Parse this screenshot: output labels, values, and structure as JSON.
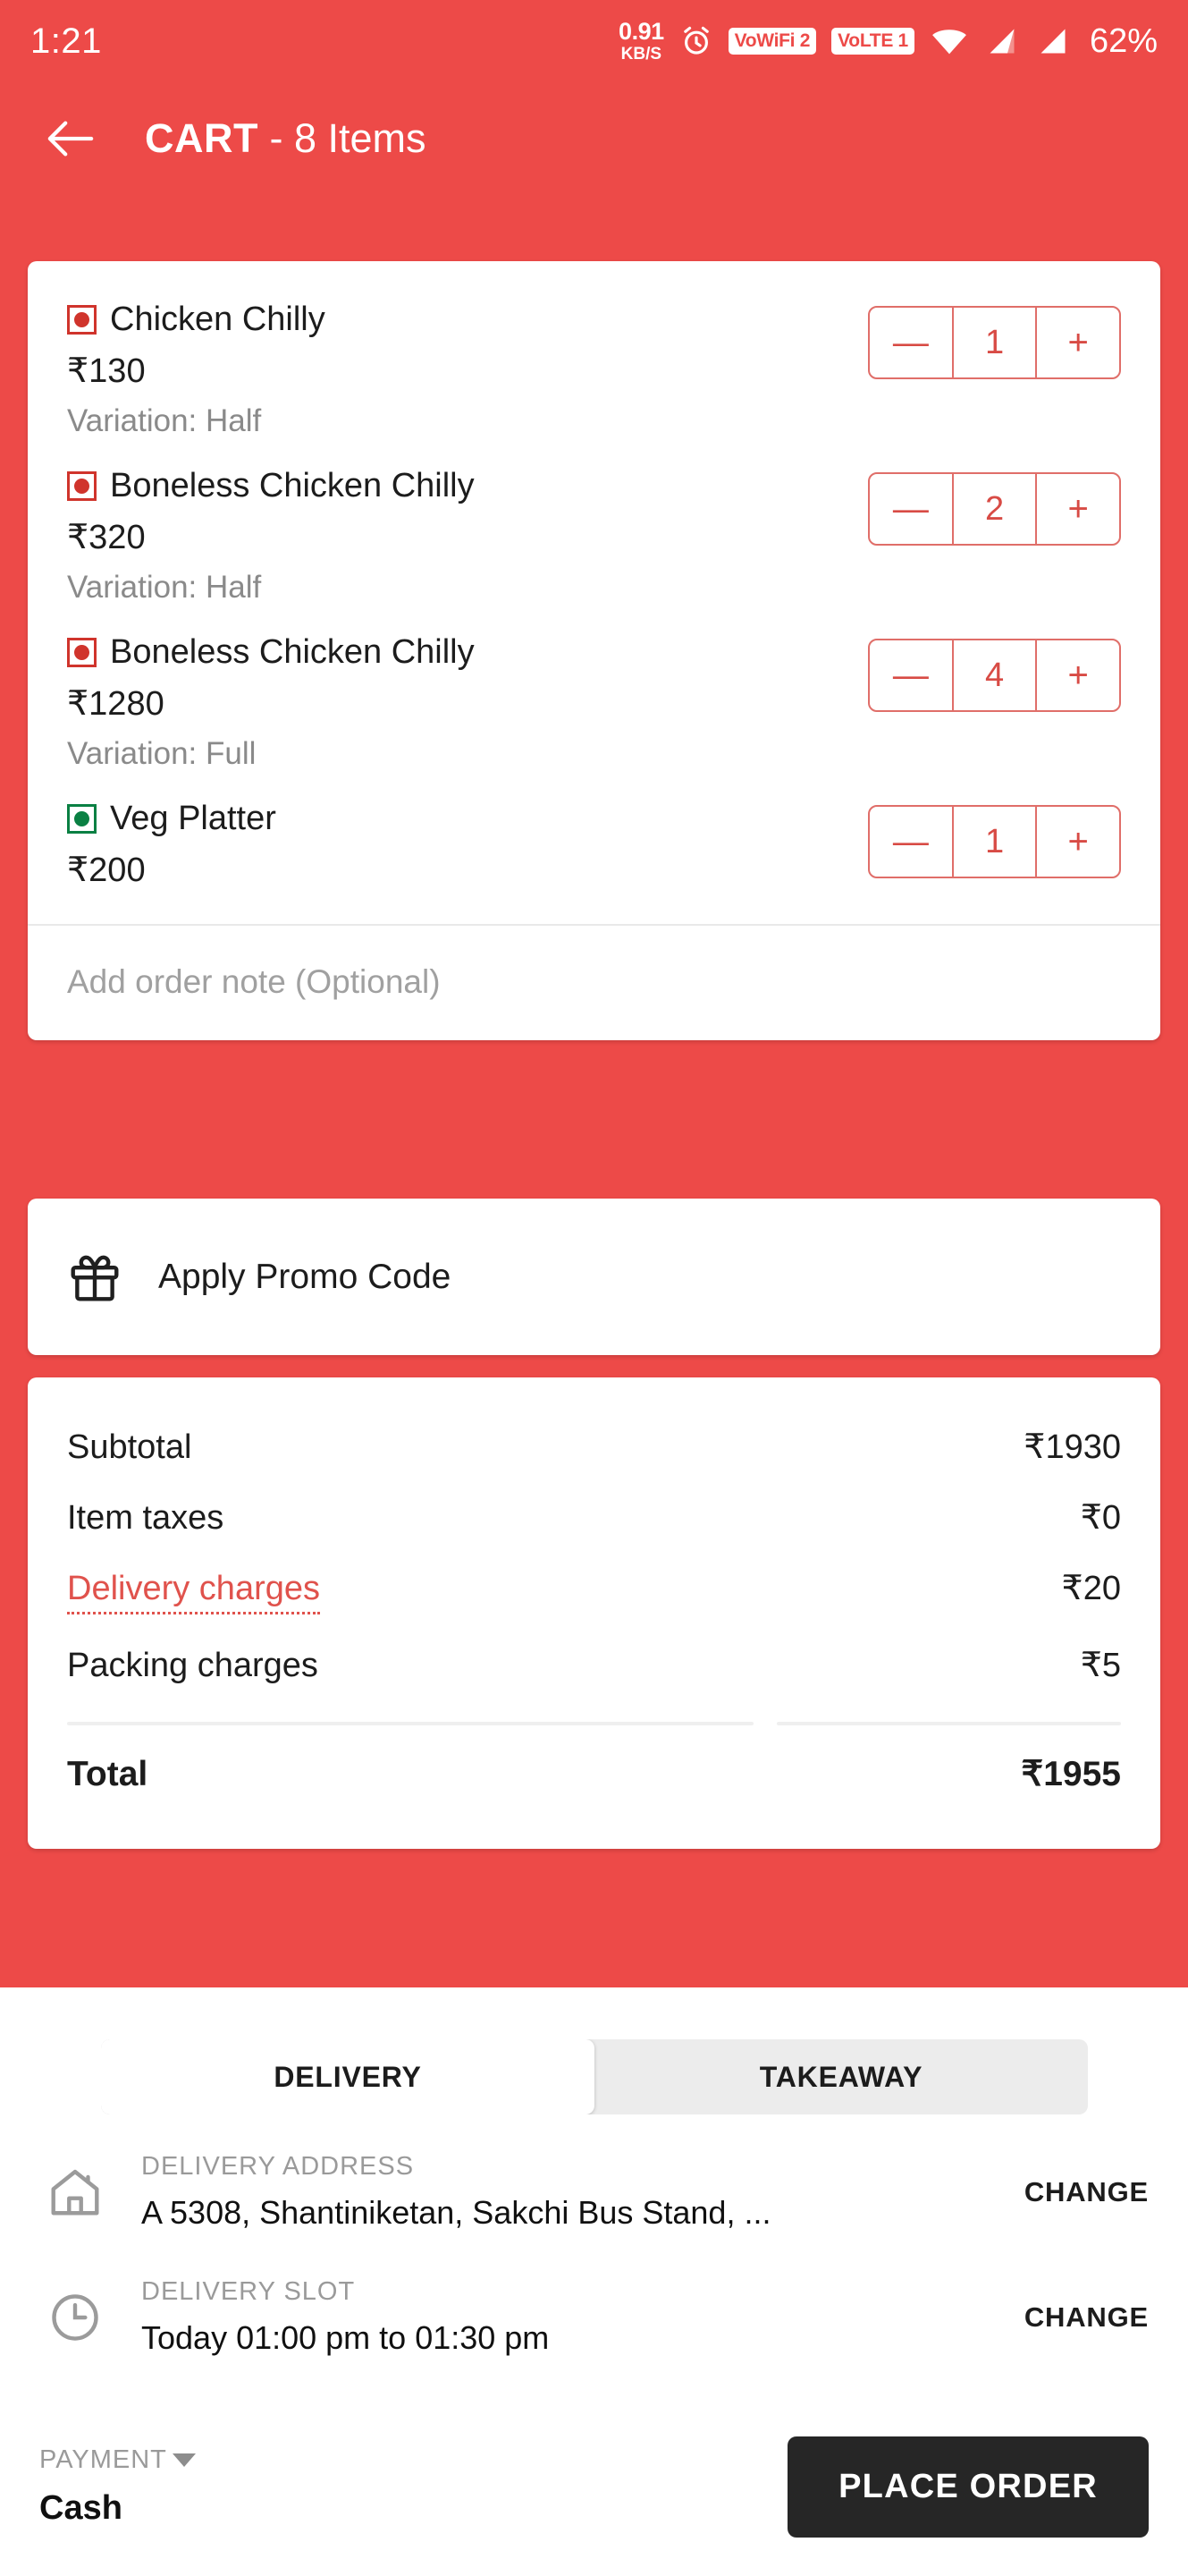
{
  "theme": {
    "primary": "#ED4A48",
    "accent_dark": "#262626",
    "veg": "#0A8043",
    "nonveg": "#D0342C"
  },
  "status_bar": {
    "time": "1:21",
    "net_speed_value": "0.91",
    "net_speed_unit": "KB/S",
    "alarm_icon": "alarm-icon",
    "vowifi_badge": "VoWiFi 2",
    "volte_badge": "VoLTE 1",
    "wifi_icon": "wifi-icon",
    "signal_icon_1": "signal-bars-icon",
    "signal_icon_2": "signal-bars-icon",
    "battery": "62%"
  },
  "app_bar": {
    "back_icon": "back-arrow-icon",
    "title": "CART",
    "subtitle": "- 8 Items"
  },
  "cart": {
    "items": [
      {
        "diet": "non-veg",
        "name": "Chicken Chilly",
        "price": "₹130",
        "variation": "Variation: Half",
        "qty": "1",
        "minus": "—",
        "plus": "+"
      },
      {
        "diet": "non-veg",
        "name": "Boneless Chicken Chilly",
        "price": "₹320",
        "variation": "Variation: Half",
        "qty": "2",
        "minus": "—",
        "plus": "+"
      },
      {
        "diet": "non-veg",
        "name": "Boneless Chicken Chilly",
        "price": "₹1280",
        "variation": "Variation: Full",
        "qty": "4",
        "minus": "—",
        "plus": "+"
      },
      {
        "diet": "veg",
        "name": "Veg Platter",
        "price": "₹200",
        "variation": "",
        "qty": "1",
        "minus": "—",
        "plus": "+"
      }
    ],
    "note_placeholder": "Add order note (Optional)"
  },
  "promo": {
    "icon": "gift-icon",
    "label": "Apply Promo Code"
  },
  "bill": {
    "rows": [
      {
        "label": "Subtotal",
        "value": "₹1930",
        "highlight": false
      },
      {
        "label": "Item taxes",
        "value": "₹0",
        "highlight": false
      },
      {
        "label": "Delivery charges",
        "value": "₹20",
        "highlight": true
      },
      {
        "label": "Packing charges",
        "value": "₹5",
        "highlight": false
      }
    ],
    "total_label": "Total",
    "total_value": "₹1955"
  },
  "order_type": {
    "options": [
      "DELIVERY",
      "TAKEAWAY"
    ],
    "selected": "DELIVERY"
  },
  "delivery_address": {
    "icon": "home-icon",
    "label": "DELIVERY ADDRESS",
    "value": "A 5308, Shantiniketan, Sakchi Bus Stand, ...",
    "action": "CHANGE"
  },
  "delivery_slot": {
    "icon": "clock-icon",
    "label": "DELIVERY SLOT",
    "value": "Today 01:00 pm to 01:30 pm",
    "action": "CHANGE"
  },
  "payment": {
    "label": "PAYMENT",
    "caret_icon": "chevron-down-icon",
    "method": "Cash",
    "place_order_label": "PLACE ORDER"
  }
}
